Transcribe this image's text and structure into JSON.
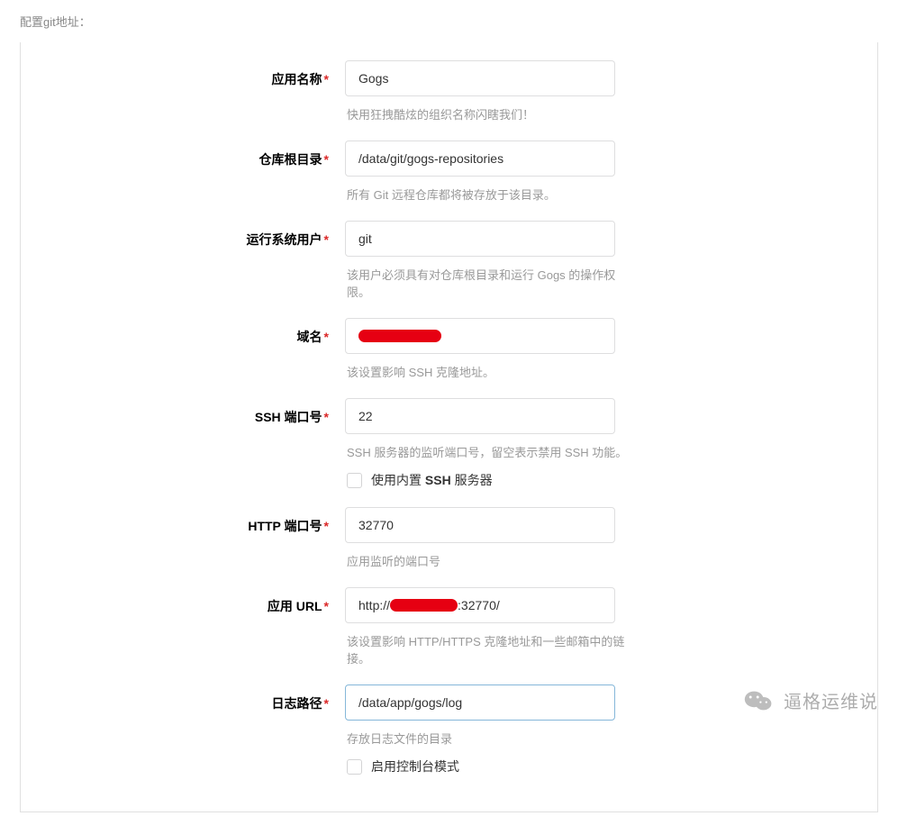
{
  "section_title": "配置git地址：",
  "fields": {
    "app_name": {
      "label": "应用名称",
      "value": "Gogs",
      "hint": "快用狂拽酷炫的组织名称闪瞎我们！"
    },
    "repo_root": {
      "label": "仓库根目录",
      "value": "/data/git/gogs-repositories",
      "hint": "所有 Git 远程仓库都将被存放于该目录。"
    },
    "run_user": {
      "label": "运行系统用户",
      "value": "git",
      "hint": "该用户必须具有对仓库根目录和运行 Gogs 的操作权限。"
    },
    "domain": {
      "label": "域名",
      "value": "",
      "hint": "该设置影响 SSH 克隆地址。"
    },
    "ssh_port": {
      "label": "SSH 端口号",
      "value": "22",
      "hint": "SSH 服务器的监听端口号，留空表示禁用 SSH 功能。",
      "checkbox_label_prefix": "使用内置 ",
      "checkbox_label_bold": "SSH",
      "checkbox_label_suffix": " 服务器"
    },
    "http_port": {
      "label": "HTTP 端口号",
      "value": "32770",
      "hint": "应用监听的端口号"
    },
    "app_url": {
      "label": "应用 URL",
      "prefix": "http://",
      "suffix": ":32770/",
      "hint": "该设置影响 HTTP/HTTPS 克隆地址和一些邮箱中的链接。"
    },
    "log_path": {
      "label": "日志路径",
      "value": "/data/app/gogs/log",
      "hint": "存放日志文件的目录",
      "checkbox_label": "启用控制台模式"
    }
  },
  "watermark": "逼格运维说"
}
